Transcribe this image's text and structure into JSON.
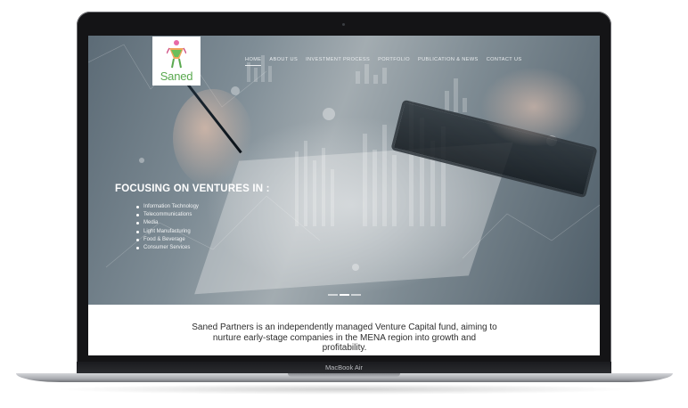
{
  "device": {
    "label": "MacBook Air"
  },
  "site": {
    "logo_text": "Saned",
    "nav": [
      {
        "label": "HOME",
        "active": true
      },
      {
        "label": "ABOUT US",
        "active": false
      },
      {
        "label": "INVESTMENT PROCESS",
        "active": false
      },
      {
        "label": "PORTFOLIO",
        "active": false
      },
      {
        "label": "PUBLICATION & NEWS",
        "active": false
      },
      {
        "label": "CONTACT US",
        "active": false
      }
    ],
    "hero": {
      "title": "FOCUSING ON VENTURES IN :",
      "sectors": [
        "Information Technology",
        "Telecommunications",
        "Media",
        "Light Manufacturing",
        "Food & Beverage",
        "Consumer Services"
      ],
      "slides": 3,
      "active_slide": 1
    },
    "intro": {
      "text": "Saned Partners is an independently managed Venture Capital fund, aiming to nurture early-stage companies in the MENA region into growth and profitability."
    }
  },
  "colors": {
    "accent_green": "#5aa94f",
    "nav_text": "#e9ecee",
    "body_text": "#2e2e2e"
  }
}
